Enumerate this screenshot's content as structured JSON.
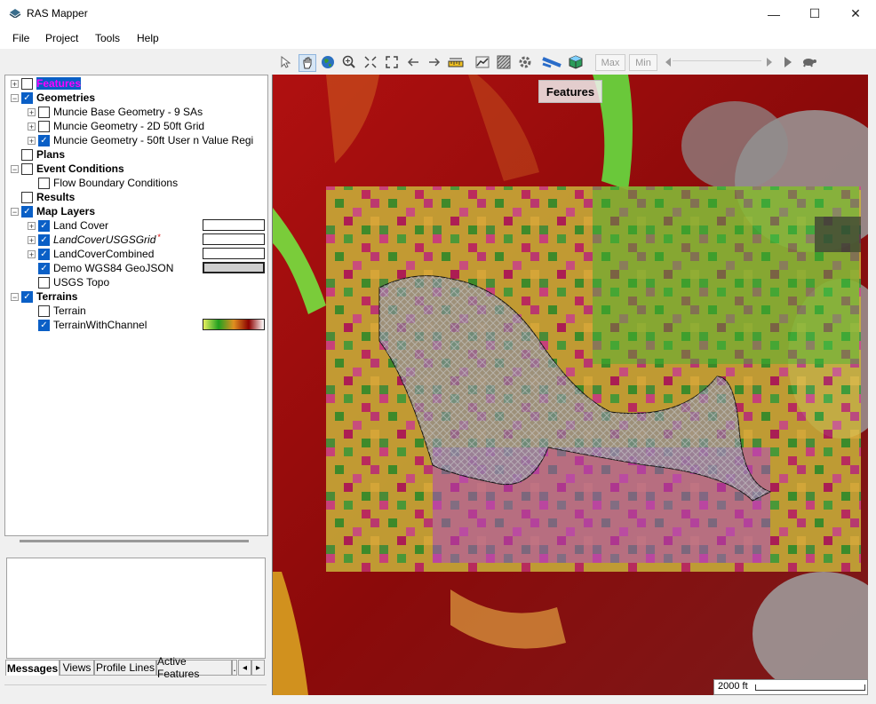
{
  "window": {
    "title": "RAS Mapper",
    "minimize_glyph": "—",
    "maximize_glyph": "☐",
    "close_glyph": "✕"
  },
  "menu": [
    "File",
    "Project",
    "Tools",
    "Help"
  ],
  "toolbar": {
    "max_label": "Max",
    "min_label": "Min",
    "icons": [
      "pointer-icon",
      "pan-hand-icon",
      "globe-icon",
      "zoom-in-icon",
      "zoom-extents-icon",
      "full-extent-icon",
      "back-arrow-icon",
      "forward-arrow-icon",
      "measure-icon",
      "profile-icon",
      "grid-icon",
      "settings-wrench-icon",
      "layers-icon",
      "3d-cube-icon",
      "play-icon",
      "turtle-icon"
    ]
  },
  "tree": [
    {
      "label": "Features",
      "level": 0,
      "expander": "+",
      "checked": false,
      "bold": true,
      "highlighted": true
    },
    {
      "label": "Geometries",
      "level": 0,
      "expander": "−",
      "checked": true,
      "bold": true
    },
    {
      "label": "Muncie Base Geometry - 9 SAs",
      "level": 1,
      "expander": "+",
      "checked": false
    },
    {
      "label": "Muncie Geometry - 2D 50ft Grid",
      "level": 1,
      "expander": "+",
      "checked": false
    },
    {
      "label": "Muncie Geometry - 50ft User n Value Regi",
      "level": 1,
      "expander": "+",
      "checked": true
    },
    {
      "label": "Plans",
      "level": 0,
      "expander": "",
      "checked": false,
      "bold": true
    },
    {
      "label": "Event Conditions",
      "level": 0,
      "expander": "−",
      "checked": false,
      "bold": true
    },
    {
      "label": "Flow Boundary Conditions",
      "level": 1,
      "expander": "",
      "checked": false
    },
    {
      "label": "Results",
      "level": 0,
      "expander": "",
      "checked": false,
      "bold": true
    },
    {
      "label": "Map Layers",
      "level": 0,
      "expander": "−",
      "checked": true,
      "bold": true
    },
    {
      "label": "Land Cover",
      "level": 1,
      "expander": "+",
      "checked": true,
      "legend": "white"
    },
    {
      "label": "LandCoverUSGSGrid",
      "level": 1,
      "expander": "+",
      "checked": true,
      "italic": true,
      "marker": "*",
      "legend": "white"
    },
    {
      "label": "LandCoverCombined",
      "level": 1,
      "expander": "+",
      "checked": true,
      "legend": "white"
    },
    {
      "label": "Demo WGS84 GeoJSON",
      "level": 1,
      "expander": "",
      "checked": true,
      "legend": "gray"
    },
    {
      "label": "USGS Topo",
      "level": 1,
      "expander": "",
      "checked": false
    },
    {
      "label": "Terrains",
      "level": 0,
      "expander": "−",
      "checked": true,
      "bold": true
    },
    {
      "label": "Terrain",
      "level": 1,
      "expander": "",
      "checked": false
    },
    {
      "label": "TerrainWithChannel",
      "level": 1,
      "expander": "",
      "checked": true,
      "legend": "ramp"
    }
  ],
  "tabs": [
    "Messages",
    "Views",
    "Profile Lines",
    "Active Features",
    "."
  ],
  "tab_arrows": [
    "◂",
    "▸"
  ],
  "map": {
    "overlay_label": "Features",
    "scale_label": "2000 ft"
  },
  "colors": {
    "selection": "#0a5fc6",
    "features_highlight": "#ff00ff",
    "terrain_ramp": [
      "#e8f060",
      "#20a020",
      "#e09020",
      "#8b0000",
      "#ffffff"
    ]
  }
}
